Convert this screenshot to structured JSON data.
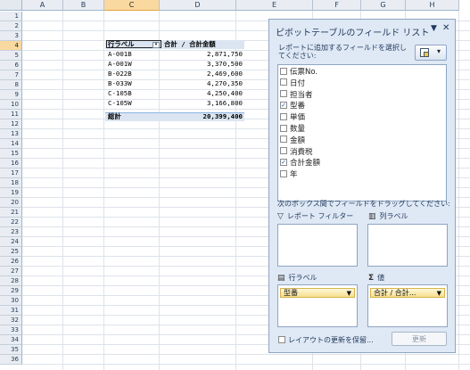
{
  "columns": [
    "A",
    "B",
    "C",
    "D",
    "E",
    "F",
    "G",
    "H"
  ],
  "selected_column": "C",
  "rows": [
    "1",
    "2",
    "3",
    "4",
    "5",
    "6",
    "7",
    "8",
    "9",
    "10",
    "11",
    "12",
    "13",
    "14",
    "15",
    "16",
    "17",
    "18",
    "19",
    "20",
    "21",
    "22",
    "23",
    "24",
    "25",
    "26",
    "27",
    "28",
    "29",
    "30",
    "31",
    "32",
    "33",
    "34",
    "35",
    "36"
  ],
  "selected_row": "4",
  "pivot": {
    "row_header": "行ラベル",
    "value_header": "合計 / 合計金額",
    "rows": [
      {
        "label": "A-001B",
        "value": "2,871,750"
      },
      {
        "label": "A-001W",
        "value": "3,370,500"
      },
      {
        "label": "B-022B",
        "value": "2,469,600"
      },
      {
        "label": "B-033W",
        "value": "4,270,350"
      },
      {
        "label": "C-105B",
        "value": "4,250,400"
      },
      {
        "label": "C-105W",
        "value": "3,166,800"
      }
    ],
    "total_label": "総計",
    "total_value": "20,399,400"
  },
  "pane": {
    "title": "ピボットテーブルのフィールド リスト",
    "dropdown_glyph": "▼",
    "close_glyph": "✕",
    "instruction": "レポートに追加するフィールドを選択してください:",
    "layout_arrow": "▾",
    "fields": [
      {
        "label": "伝票No.",
        "checked": false
      },
      {
        "label": "日付",
        "checked": false
      },
      {
        "label": "担当者",
        "checked": false
      },
      {
        "label": "型番",
        "checked": true
      },
      {
        "label": "単価",
        "checked": false
      },
      {
        "label": "数量",
        "checked": false
      },
      {
        "label": "金額",
        "checked": false
      },
      {
        "label": "消費税",
        "checked": false
      },
      {
        "label": "合計金額",
        "checked": true
      },
      {
        "label": "年",
        "checked": false
      }
    ],
    "drag_instruction": "次のボックス間でフィールドをドラッグしてください:",
    "report_filter_label": "レポート フィルター",
    "column_labels_label": "列ラベル",
    "row_labels_label": "行ラベル",
    "values_label": "値",
    "row_chip": "型番",
    "value_chip": "合計 / 合計...",
    "chip_dd": "▼",
    "defer_label": "レイアウトの更新を保留...",
    "update_label": "更新",
    "icons": {
      "filter": "filter-icon",
      "columns": "column-labels-icon",
      "rows": "row-labels-icon",
      "values": "sigma-icon"
    }
  },
  "colors": {
    "header_bg": "#e9edf3",
    "selected_header": "#f9d99f",
    "pivot_band": "#dbe5f1",
    "pane_bg": "#dfe8f5"
  }
}
